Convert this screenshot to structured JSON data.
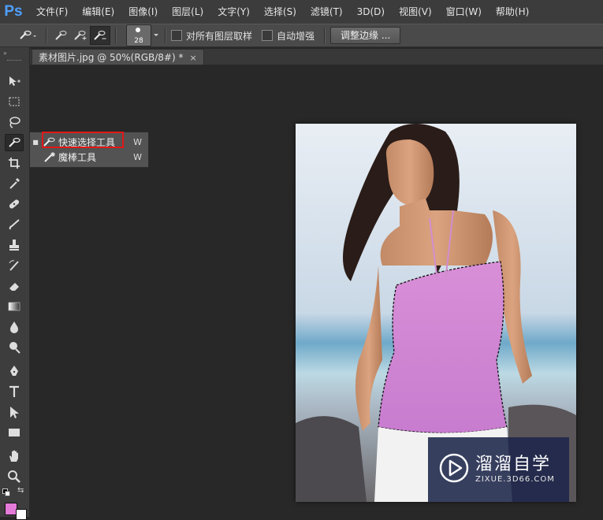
{
  "app": {
    "logo": "Ps"
  },
  "menu": [
    "文件(F)",
    "编辑(E)",
    "图像(I)",
    "图层(L)",
    "文字(Y)",
    "选择(S)",
    "滤镜(T)",
    "3D(D)",
    "视图(V)",
    "窗口(W)",
    "帮助(H)"
  ],
  "options": {
    "brush_size": "28",
    "sample_all_layers": "对所有图层取样",
    "auto_enhance": "自动增强",
    "refine_edge": "调整边缘 ..."
  },
  "document": {
    "tab_title": "素材图片.jpg @ 50%(RGB/8#) *",
    "close": "×"
  },
  "flyout": {
    "items": [
      {
        "label": "快速选择工具",
        "shortcut": "W",
        "icon": "quick-selection-icon",
        "selected": true
      },
      {
        "label": "魔棒工具",
        "shortcut": "W",
        "icon": "magic-wand-icon",
        "selected": false
      }
    ]
  },
  "colors": {
    "foreground": "#e47ad8",
    "background": "#ffffff",
    "highlight": "#e21818"
  },
  "watermark": {
    "title": "溜溜自学",
    "url": "ZIXUE.3D66.COM"
  }
}
